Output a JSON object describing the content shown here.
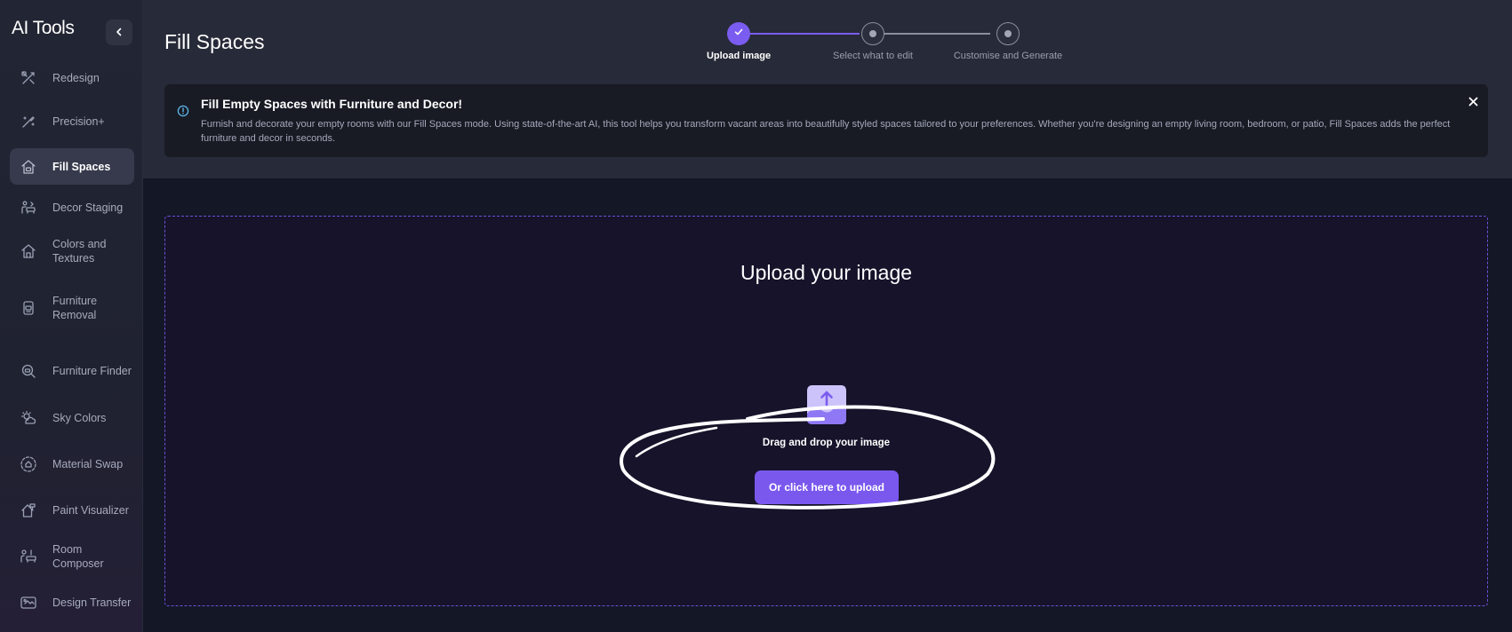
{
  "app": {
    "title": "AI Tools"
  },
  "sidebar": {
    "collapse_icon": "chevron-left-icon",
    "items": [
      {
        "label": "Redesign",
        "icon": "redesign-icon",
        "active": false
      },
      {
        "label": "Precision+",
        "icon": "precision-icon",
        "active": false
      },
      {
        "label": "Fill Spaces",
        "icon": "fill-spaces-icon",
        "active": true
      },
      {
        "label": "Decor Staging",
        "icon": "decor-staging-icon",
        "active": false
      },
      {
        "label": "Colors and Textures",
        "icon": "colors-textures-icon",
        "active": false
      },
      {
        "label": "Furniture Removal",
        "icon": "furniture-removal-icon",
        "active": false
      },
      {
        "label": "Furniture Finder",
        "icon": "furniture-finder-icon",
        "active": false
      },
      {
        "label": "Sky Colors",
        "icon": "sky-colors-icon",
        "active": false
      },
      {
        "label": "Material Swap",
        "icon": "material-swap-icon",
        "active": false
      },
      {
        "label": "Paint Visualizer",
        "icon": "paint-visualizer-icon",
        "active": false
      },
      {
        "label": "Room Composer",
        "icon": "room-composer-icon",
        "active": false
      },
      {
        "label": "Design Transfer",
        "icon": "design-transfer-icon",
        "active": false
      }
    ]
  },
  "header": {
    "title": "Fill Spaces",
    "steps": [
      {
        "label": "Upload image",
        "state": "done"
      },
      {
        "label": "Select what to edit",
        "state": "todo"
      },
      {
        "label": "Customise and Generate",
        "state": "todo"
      }
    ]
  },
  "banner": {
    "title": "Fill Empty Spaces with Furniture and Decor!",
    "text": "Furnish and decorate your empty rooms with our Fill Spaces mode. Using state-of-the-art AI, this tool helps you transform vacant areas into beautifully styled spaces tailored to your preferences. Whether you're designing an empty living room, bedroom, or patio, Fill Spaces adds the perfect furniture and decor in seconds.",
    "icon": "info-icon",
    "close_icon": "close-icon"
  },
  "upload": {
    "title": "Upload your image",
    "drag_text": "Drag and drop your image",
    "button_label": "Or click here to upload",
    "icon": "image-upload-icon"
  },
  "colors": {
    "accent": "#7b5cf0",
    "page_bg": "#131726",
    "header_bg": "#272a38",
    "sidebar_bg": "#222634"
  }
}
